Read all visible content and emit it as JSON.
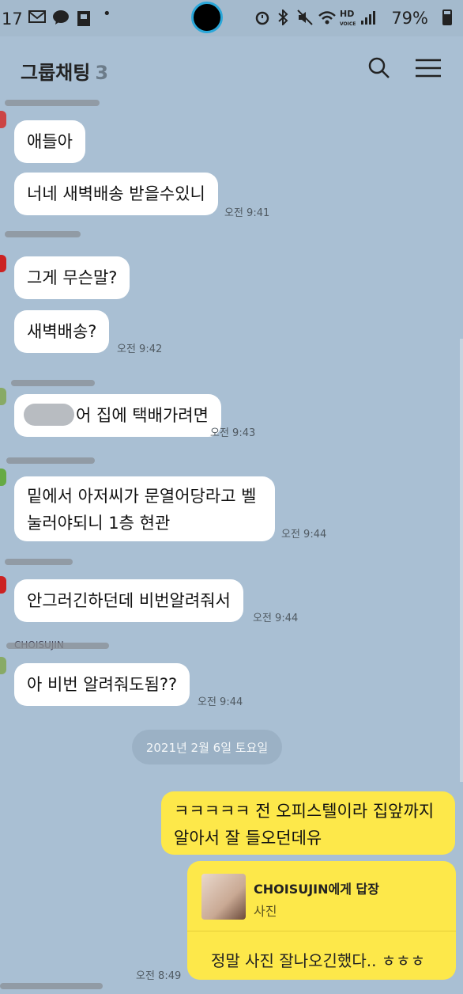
{
  "status": {
    "time": "17",
    "battery": "79%",
    "icons": [
      "mail-icon",
      "talk-icon",
      "clipboard-icon",
      "dot-icon",
      "alarm-icon",
      "bluetooth-icon",
      "mute-icon",
      "wifi-icon",
      "hd-voice-icon",
      "signal-icon",
      "battery-icon"
    ]
  },
  "header": {
    "title": "그룹채팅",
    "member_count": "3"
  },
  "messages": [
    {
      "text": "애들아"
    },
    {
      "text": "너네 새벽배송 받을수있니",
      "time": "오전 9:41"
    },
    {
      "text": "그게 무슨말?"
    },
    {
      "text": "새벽배송?",
      "time": "오전 9:42"
    },
    {
      "text": "어 집에 택배가려면",
      "time": "오전 9:43"
    },
    {
      "line1": "밑에서 아저씨가 문열어당라고 벨",
      "line2": "눌러야되니 1층 현관",
      "time": "오전 9:44"
    },
    {
      "text": "안그러긴하던데 비번알려줘서",
      "time": "오전 9:44"
    },
    {
      "name": "CHOISUJIN",
      "text": "아 비번 알려줘도됨??",
      "time": "오전 9:44"
    }
  ],
  "date_divider": "2021년 2월 6일 토요일",
  "my_message": {
    "line1": "ㅋㅋㅋㅋㅋ 전 오피스텔이라 집앞까지",
    "line2": "알아서 잘 들오던데유"
  },
  "reply": {
    "to": "CHOISUJIN에게 답장",
    "kind": "사진",
    "text": "정말 사진 잘나오긴했다.. ㅎㅎㅎ",
    "time": "오전 8:49"
  },
  "colors": {
    "background": "#a9bfd3",
    "my_bubble": "#fde84a",
    "other_bubble": "#ffffff"
  }
}
